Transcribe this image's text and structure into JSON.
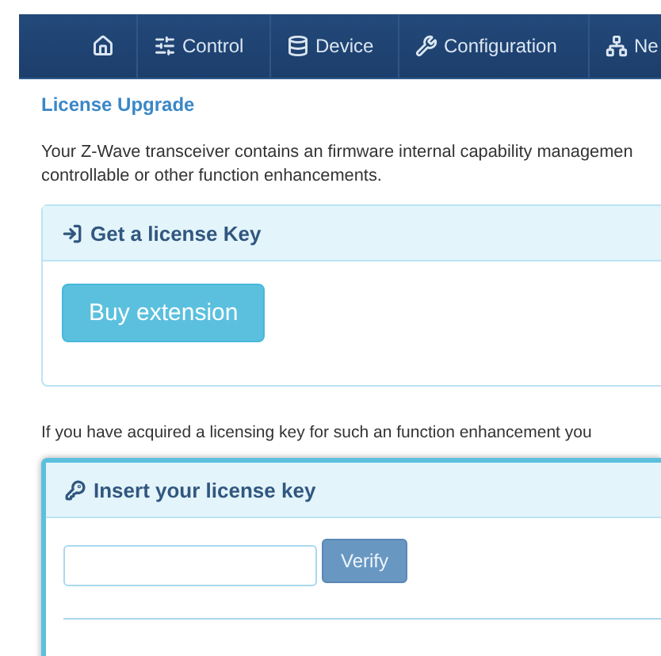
{
  "nav": [
    {
      "kind": "home"
    },
    {
      "kind": "control",
      "label": "Control"
    },
    {
      "kind": "device",
      "label": "Device"
    },
    {
      "kind": "configuration",
      "label": "Configuration"
    },
    {
      "kind": "network",
      "label": "Ne"
    }
  ],
  "title": "License Upgrade",
  "intro_lines": [
    "Your Z-Wave transceiver contains an firmware internal capability managemen",
    "controllable or other function enhancements."
  ],
  "get_panel": {
    "heading": "Get a license Key",
    "button": "Buy extension"
  },
  "acquired_text": "If you have acquired a licensing key for such an function enhancement you",
  "insert_panel": {
    "heading": "Insert your license key",
    "button": "Verify"
  }
}
